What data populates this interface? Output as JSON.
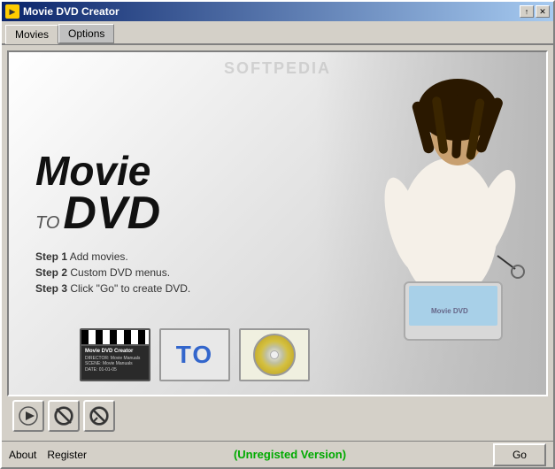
{
  "window": {
    "title": "Movie DVD Creator",
    "icon_label": "DVD"
  },
  "title_buttons": {
    "minimize": "↑",
    "close": "✕"
  },
  "tabs": {
    "movies": "Movies",
    "options": "Options"
  },
  "banner": {
    "watermark": "SOFTPEDIA",
    "title_line1": "Movie",
    "title_to": "TO",
    "title_dvd": "DVD",
    "step1": "Step 1",
    "step1_text": " Add movies.",
    "step2": "Step 2",
    "step2_text": " Custom DVD menus.",
    "step3": "Step 3",
    "step3_text": " Click \"Go\" to create DVD.",
    "arrow_label": "TO",
    "clap_line1": "Movie DVD Creator",
    "clap_line2": "DIRECTOR: Movie Manuals",
    "clap_line3": "SCENE: Movie Manuals",
    "clap_line4": "DATE: 01-01-05"
  },
  "status": {
    "about": "About",
    "register": "Register",
    "version_text": "(Unregisted Version)",
    "go_button": "Go"
  }
}
